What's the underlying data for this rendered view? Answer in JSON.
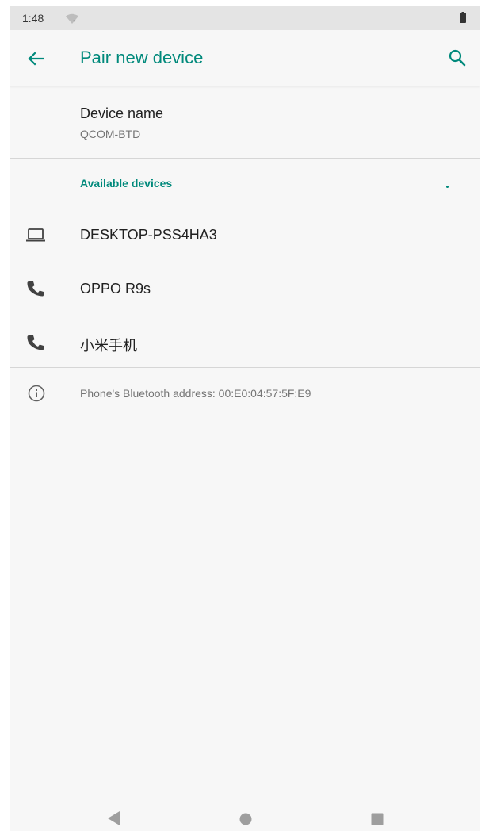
{
  "status_bar": {
    "time": "1:48",
    "wifi_icon": "wifi-icon",
    "battery_icon": "battery-icon"
  },
  "app_bar": {
    "title": "Pair new device",
    "back_icon": "arrow-back-icon",
    "search_icon": "search-icon"
  },
  "device_name": {
    "title": "Device name",
    "value": "QCOM-BTD"
  },
  "available_devices": {
    "header": "Available devices",
    "items": [
      {
        "label": "DESKTOP-PSS4HA3",
        "icon": "laptop-icon"
      },
      {
        "label": "OPPO R9s",
        "icon": "phone-icon"
      },
      {
        "label": "小米手机",
        "icon": "phone-icon"
      }
    ]
  },
  "info": {
    "icon": "info-icon",
    "text": "Phone's Bluetooth address: 00:E0:04:57:5F:E9"
  },
  "nav_bar": {
    "back_icon": "nav-back-icon",
    "home_icon": "nav-home-icon",
    "recents_icon": "nav-recents-icon"
  },
  "colors": {
    "accent": "#00897b",
    "primary_text": "#212121",
    "secondary_text": "#757575",
    "background": "#f7f7f7",
    "status_bar": "#e4e4e4"
  }
}
